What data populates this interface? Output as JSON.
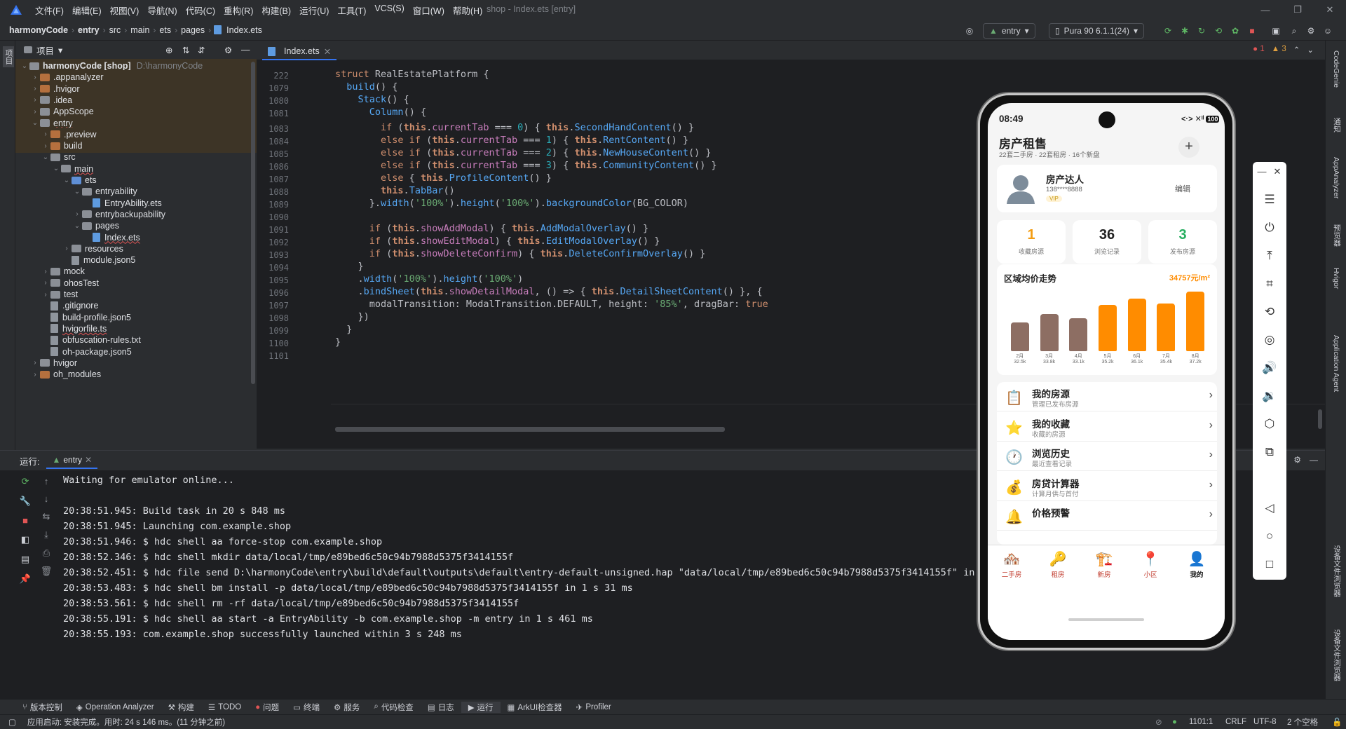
{
  "menu": [
    "文件(F)",
    "编辑(E)",
    "视图(V)",
    "导航(N)",
    "代码(C)",
    "重构(R)",
    "构建(B)",
    "运行(U)",
    "工具(T)",
    "VCS(S)",
    "窗口(W)",
    "帮助(H)"
  ],
  "window_title": "shop - Index.ets [entry]",
  "breadcrumb": [
    "harmonyCode",
    "entry",
    "src",
    "main",
    "ets",
    "pages",
    "Index.ets"
  ],
  "toolbar": {
    "module": "entry",
    "device": "Pura 90 6.1.1(24)"
  },
  "project": {
    "header": "项目",
    "rows": [
      {
        "label": "harmonyCode [shop]",
        "extra": "D:\\harmonyCode",
        "depth": 0,
        "open": true,
        "kind": "root"
      },
      {
        "label": ".appanalyzer",
        "depth": 1,
        "open": false,
        "kind": "orange"
      },
      {
        "label": ".hvigor",
        "depth": 1,
        "open": false,
        "kind": "orange"
      },
      {
        "label": ".idea",
        "depth": 1,
        "open": false,
        "kind": "folder"
      },
      {
        "label": "AppScope",
        "depth": 1,
        "open": false,
        "kind": "folder"
      },
      {
        "label": "entry",
        "depth": 1,
        "open": true,
        "kind": "folder"
      },
      {
        "label": ".preview",
        "depth": 2,
        "open": false,
        "kind": "orange"
      },
      {
        "label": "build",
        "depth": 2,
        "open": false,
        "kind": "orange"
      },
      {
        "label": "src",
        "depth": 2,
        "open": true,
        "kind": "folder"
      },
      {
        "label": "main",
        "depth": 3,
        "open": true,
        "kind": "folder"
      },
      {
        "label": "ets",
        "depth": 4,
        "open": true,
        "kind": "blue"
      },
      {
        "label": "entryability",
        "depth": 5,
        "open": true,
        "kind": "folder"
      },
      {
        "label": "EntryAbility.ets",
        "depth": 6,
        "kind": "ets"
      },
      {
        "label": "entrybackupability",
        "depth": 5,
        "open": false,
        "kind": "folder"
      },
      {
        "label": "pages",
        "depth": 5,
        "open": true,
        "kind": "folder"
      },
      {
        "label": "Index.ets",
        "depth": 6,
        "kind": "ets"
      },
      {
        "label": "resources",
        "depth": 4,
        "open": false,
        "kind": "folder"
      },
      {
        "label": "module.json5",
        "depth": 4,
        "kind": "file"
      },
      {
        "label": "mock",
        "depth": 2,
        "open": false,
        "kind": "folder"
      },
      {
        "label": "ohosTest",
        "depth": 2,
        "open": false,
        "kind": "folder"
      },
      {
        "label": "test",
        "depth": 2,
        "open": false,
        "kind": "folder"
      },
      {
        "label": ".gitignore",
        "depth": 2,
        "kind": "file"
      },
      {
        "label": "build-profile.json5",
        "depth": 2,
        "kind": "file"
      },
      {
        "label": "hvigorfile.ts",
        "depth": 2,
        "kind": "file"
      },
      {
        "label": "obfuscation-rules.txt",
        "depth": 2,
        "kind": "file"
      },
      {
        "label": "oh-package.json5",
        "depth": 2,
        "kind": "file"
      },
      {
        "label": "hvigor",
        "depth": 1,
        "open": false,
        "kind": "folder"
      },
      {
        "label": "oh_modules",
        "depth": 1,
        "open": false,
        "kind": "orange"
      }
    ]
  },
  "editor": {
    "tab": "Index.ets",
    "problems": {
      "errors": "1",
      "warnings": "3"
    },
    "lines": [
      {
        "n": "222",
        "html": "<span class='kw'>struct</span> <span style='color:#bcbec4'>RealEstatePlatform</span> {"
      },
      {
        "n": "1079",
        "html": "  <span class='fn'>build</span>() {"
      },
      {
        "n": "1080",
        "html": "    <span class='fn'>Stack</span>() {"
      },
      {
        "n": "1081",
        "html": "      <span class='fn'>Column</span>() {"
      },
      {
        "n": "1083",
        "html": "        <span class='kw'>if</span> (<span class='th'>this</span>.<span class='pl'>currentTab</span> === <span class='num'>0</span>) { <span class='th'>this</span>.<span class='fn'>SecondHandContent</span>() }"
      },
      {
        "n": "1084",
        "html": "        <span class='kw'>else if</span> (<span class='th'>this</span>.<span class='pl'>currentTab</span> === <span class='num'>1</span>) { <span class='th'>this</span>.<span class='fn'>RentContent</span>() }"
      },
      {
        "n": "1085",
        "html": "        <span class='kw'>else if</span> (<span class='th'>this</span>.<span class='pl'>currentTab</span> === <span class='num'>2</span>) { <span class='th'>this</span>.<span class='fn'>NewHouseContent</span>() }"
      },
      {
        "n": "1086",
        "html": "        <span class='kw'>else if</span> (<span class='th'>this</span>.<span class='pl'>currentTab</span> === <span class='num'>3</span>) { <span class='th'>this</span>.<span class='fn'>CommunityContent</span>() }"
      },
      {
        "n": "1087",
        "html": "        <span class='kw'>else</span> { <span class='th'>this</span>.<span class='fn'>ProfileContent</span>() }"
      },
      {
        "n": "1088",
        "html": "        <span class='th'>this</span>.<span class='fn'>TabBar</span>()"
      },
      {
        "n": "1089",
        "html": "      }.<span class='fn'>width</span>(<span class='str'>'100%'</span>).<span class='fn'>height</span>(<span class='str'>'100%'</span>).<span class='fn'>backgroundColor</span>(BG_COLOR)"
      },
      {
        "n": "1090",
        "html": ""
      },
      {
        "n": "1091",
        "html": "      <span class='kw'>if</span> (<span class='th'>this</span>.<span class='pl'>showAddModal</span>) { <span class='th'>this</span>.<span class='fn'>AddModalOverlay</span>() }"
      },
      {
        "n": "1092",
        "html": "      <span class='kw'>if</span> (<span class='th'>this</span>.<span class='pl'>showEditModal</span>) { <span class='th'>this</span>.<span class='fn'>EditModalOverlay</span>() }"
      },
      {
        "n": "1093",
        "html": "      <span class='kw'>if</span> (<span class='th'>this</span>.<span class='pl'>showDeleteConfirm</span>) { <span class='th'>this</span>.<span class='fn'>DeleteConfirmOverlay</span>() }"
      },
      {
        "n": "1094",
        "html": "    }"
      },
      {
        "n": "1095",
        "html": "    .<span class='fn'>width</span>(<span class='str'>'100%'</span>).<span class='fn'>height</span>(<span class='str'>'100%'</span>)"
      },
      {
        "n": "1096",
        "html": "    .<span class='fn'>bindSheet</span>(<span class='th'>this</span>.<span class='pl'>showDetailModal</span>, () => { <span class='th'>this</span>.<span class='fn'>DetailSheetContent</span>() }, {"
      },
      {
        "n": "1097",
        "html": "      modalTransition: ModalTransition.DEFAULT, height: <span class='str'>'85%'</span>, dragBar: <span class='kw'>true</span>"
      },
      {
        "n": "1098",
        "html": "    })"
      },
      {
        "n": "1099",
        "html": "  }"
      },
      {
        "n": "1100",
        "html": "}"
      },
      {
        "n": "1101",
        "html": ""
      }
    ]
  },
  "run": {
    "label": "运行:",
    "tab": "entry",
    "lines": [
      "Waiting for emulator online...",
      "",
      "20:38:51.945: Build task in 20 s 848 ms",
      "20:38:51.945: Launching com.example.shop",
      "20:38:51.946: $ hdc shell aa force-stop com.example.shop",
      "20:38:52.346: $ hdc shell mkdir data/local/tmp/e89bed6c50c94b7988d5375f3414155f",
      "20:38:52.451: $ hdc file send D:\\harmonyCode\\entry\\build\\default\\outputs\\default\\entry-default-unsigned.hap \"data/local/tmp/e89bed6c50c94b7988d5375f3414155f\" in 16",
      "20:38:53.483: $ hdc shell bm install -p data/local/tmp/e89bed6c50c94b7988d5375f3414155f in 1 s 31 ms",
      "20:38:53.561: $ hdc shell rm -rf data/local/tmp/e89bed6c50c94b7988d5375f3414155f",
      "20:38:55.191: $ hdc shell aa start -a EntryAbility -b com.example.shop -m entry in 1 s 461 ms",
      "20:38:55.193: com.example.shop successfully launched within 3 s 248 ms"
    ]
  },
  "bottom_tools": [
    "版本控制",
    "Operation Analyzer",
    "构建",
    "TODO",
    "问题",
    "终端",
    "服务",
    "代码检查",
    "日志",
    "运行",
    "ArkUI检查器",
    "Profiler"
  ],
  "status": {
    "left": "应用启动: 安装完成。用时: 24 s 146 ms。(11 分钟之前)",
    "pos": "1101:1",
    "eol": "CRLF",
    "enc": "UTF-8",
    "indent": "2 个空格"
  },
  "left_strip": {
    "top": "项目",
    "bottom1": "书签",
    "bottom2": "结构"
  },
  "right_strip": [
    "CodeGenie",
    "通知",
    "AppAnalyzer",
    "预览器",
    "Hvigor",
    "Application Agent",
    "设备文件浏览器",
    "设备文件浏览器"
  ],
  "phone": {
    "time": "08:49",
    "battery": "100",
    "title": "房产租售",
    "subtitle": "22套二手房 · 22套租房 · 16个新盘",
    "add": "+",
    "profile": {
      "name": "房产达人",
      "phone": "138****8888",
      "vip": "VIP",
      "edit": "编辑"
    },
    "stats": [
      {
        "value": "1",
        "label": "收藏房源",
        "color": "#f39c12"
      },
      {
        "value": "36",
        "label": "浏览记录",
        "color": "#222222"
      },
      {
        "value": "3",
        "label": "发布房源",
        "color": "#27ae60"
      }
    ],
    "trend_title": "区域均价走势",
    "trend_value": "34757元/m²",
    "menu": [
      {
        "icon": "📋",
        "title": "我的房源",
        "sub": "管理已发布房源"
      },
      {
        "icon": "⭐",
        "title": "我的收藏",
        "sub": "收藏的房源"
      },
      {
        "icon": "🕐",
        "title": "浏览历史",
        "sub": "最近查看记录"
      },
      {
        "icon": "💰",
        "title": "房贷计算器",
        "sub": "计算月供与首付"
      },
      {
        "icon": "🔔",
        "title": "价格预警",
        "sub": ""
      }
    ],
    "nav": [
      {
        "icon": "🏘️",
        "label": "二手房"
      },
      {
        "icon": "🔑",
        "label": "租房"
      },
      {
        "icon": "🏗️",
        "label": "新房"
      },
      {
        "icon": "📍",
        "label": "小区"
      },
      {
        "icon": "👤",
        "label": "我的"
      }
    ]
  },
  "chart_data": {
    "type": "bar",
    "title": "区域均价走势",
    "categories": [
      "2月",
      "3月",
      "4月",
      "5月",
      "6月",
      "7月",
      "8月"
    ],
    "value_labels": [
      "32.5k",
      "33.8k",
      "33.1k",
      "35.2k",
      "36.1k",
      "35.4k",
      "37.2k"
    ],
    "values": [
      32.5,
      33.8,
      33.1,
      35.2,
      36.1,
      35.4,
      37.2
    ],
    "bar_colors": [
      "#8d6e63",
      "#8d6e63",
      "#8d6e63",
      "#ff8c00",
      "#ff8c00",
      "#ff8c00",
      "#ff8c00"
    ],
    "ylim": [
      28,
      38
    ]
  }
}
